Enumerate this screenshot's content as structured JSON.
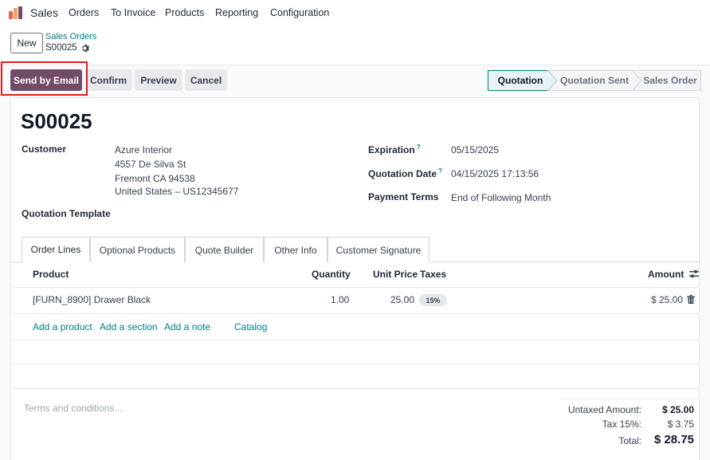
{
  "nav": {
    "app_name": "Sales",
    "items": [
      "Orders",
      "To Invoice",
      "Products",
      "Reporting",
      "Configuration"
    ]
  },
  "control_panel": {
    "new_label": "New",
    "breadcrumb_parent": "Sales Orders",
    "breadcrumb_current": "S00025"
  },
  "actions": {
    "send_email": "Send by Email",
    "confirm": "Confirm",
    "preview": "Preview",
    "cancel": "Cancel"
  },
  "status": {
    "stages": [
      "Quotation",
      "Quotation Sent",
      "Sales Order"
    ],
    "active": "Quotation"
  },
  "form": {
    "title": "S00025",
    "customer_label": "Customer",
    "customer_lines": [
      "Azure Interior",
      "4557 De Silva St",
      "Fremont CA 94538",
      "United States – US12345677"
    ],
    "template_label": "Quotation Template",
    "expiration_label": "Expiration",
    "expiration_value": "05/15/2025",
    "quotation_date_label": "Quotation Date",
    "quotation_date_value": "04/15/2025 17:13:56",
    "payment_terms_label": "Payment Terms",
    "payment_terms_value": "End of Following Month",
    "help_mark": "?"
  },
  "tabs": [
    "Order Lines",
    "Optional Products",
    "Quote Builder",
    "Other Info",
    "Customer Signature"
  ],
  "table": {
    "headers": {
      "product": "Product",
      "quantity": "Quantity",
      "unit_price": "Unit Price",
      "taxes": "Taxes",
      "amount": "Amount"
    },
    "rows": [
      {
        "product": "[FURN_8900] Drawer Black",
        "quantity": "1.00",
        "unit_price": "25.00",
        "tax": "15%",
        "amount": "$ 25.00"
      }
    ],
    "add_product": "Add a product",
    "add_section": "Add a section",
    "add_note": "Add a note",
    "catalog": "Catalog"
  },
  "terms_placeholder": "Terms and conditions...",
  "totals": {
    "untaxed_label": "Untaxed Amount:",
    "untaxed_value": "$ 25.00",
    "tax_label": "Tax 15%:",
    "tax_value": "$ 3.75",
    "total_label": "Total:",
    "total_value": "$ 28.75"
  },
  "colors": {
    "brand": "#714b67",
    "link": "#017e84",
    "highlight": "#e01e1e"
  }
}
